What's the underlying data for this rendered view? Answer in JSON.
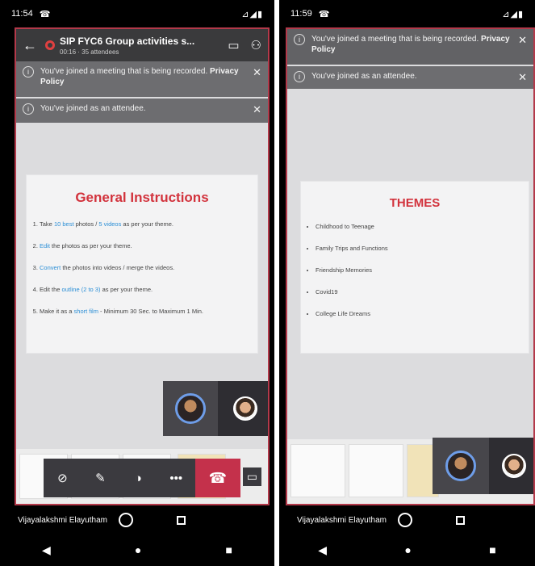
{
  "left": {
    "status": {
      "time": "11:54",
      "call_icon": "☎",
      "icons": "⊿◢▮"
    },
    "meeting": {
      "title": "SIP FYC6 Group activities s...",
      "subtitle": "00:16 · 35 attendees"
    },
    "banners": [
      {
        "text": "You've joined a meeting that is being recorded.",
        "link": "Privacy Policy"
      },
      {
        "text": "You've joined as an attendee.",
        "link": ""
      }
    ],
    "slide": {
      "title": "General Instructions",
      "items": [
        {
          "pre": "Take ",
          "hl": "10 best",
          "mid": " photos / ",
          "hl2": "5 videos",
          "post": " as per your theme."
        },
        {
          "pre": "",
          "hl": "Edit",
          "mid": " the photos as per your theme.",
          "hl2": "",
          "post": ""
        },
        {
          "pre": "",
          "hl": "Convert",
          "mid": " the photos into videos / merge the videos.",
          "hl2": "",
          "post": ""
        },
        {
          "pre": "Edit the ",
          "hl": "outline (2 to 3)",
          "mid": " as per your theme.",
          "hl2": "",
          "post": ""
        },
        {
          "pre": "Make it as a ",
          "hl": "short film",
          "mid": " - Minimum 30 Sec. to Maximum 1 Min.",
          "hl2": "",
          "post": ""
        }
      ]
    },
    "user": "Vijayalakshmi Elayutham"
  },
  "right": {
    "status": {
      "time": "11:59",
      "call_icon": "☎",
      "icons": "⊿◢▮"
    },
    "banners": [
      {
        "text": "You've joined a meeting that is being recorded.",
        "link": "Privacy Policy"
      },
      {
        "text": "You've joined as an attendee.",
        "link": ""
      }
    ],
    "slide": {
      "title": "THEMES",
      "items": [
        "Childhood to Teenage",
        "Family Trips and Functions",
        "Friendship Memories",
        "Covid19",
        "College Life Dreams"
      ]
    },
    "user": "Vijayalakshmi Elayutham"
  },
  "controls": {
    "camera": "⊘",
    "mic": "✎",
    "speaker": "◑",
    "more": "•••",
    "hangup": "☎",
    "share": "▭"
  },
  "nav": {
    "back": "◀",
    "home": "●",
    "recents": "■"
  },
  "colors": {
    "accent_red": "#d2323c",
    "highlight_blue": "#2c8fd6",
    "hangup": "#c4314b"
  }
}
